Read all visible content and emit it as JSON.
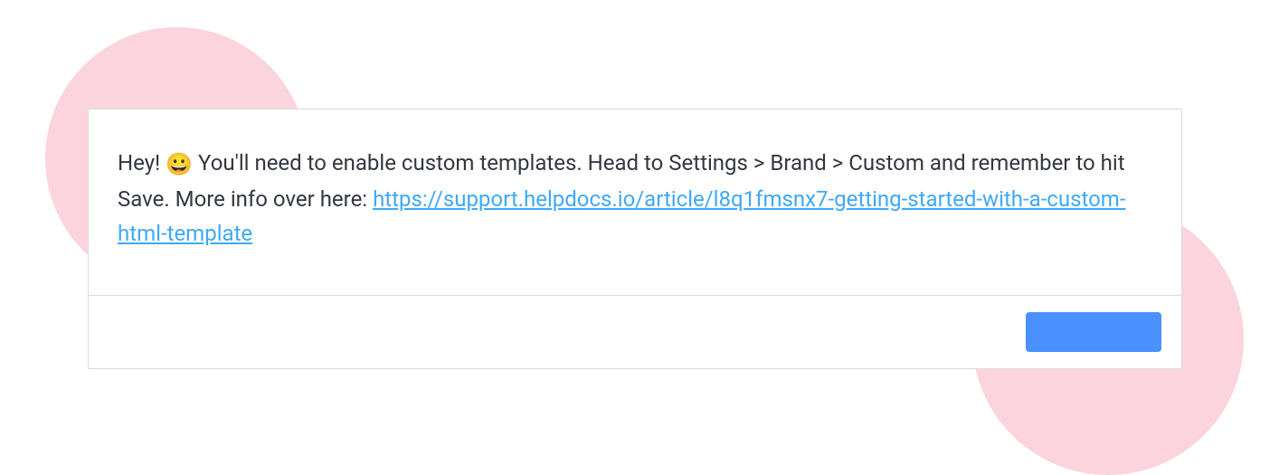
{
  "message": {
    "prefix": "Hey! ",
    "emoji": "😀",
    "text_after_emoji": " You'll need to enable custom templates. Head to Settings > Brand > Custom and remember to hit Save. More info over here: ",
    "link_text": "https://support.helpdocs.io/article/l8q1fmsnx7-getting-started-with-a-custom-html-template",
    "link_href": "https://support.helpdocs.io/article/l8q1fmsnx7-getting-started-with-a-custom-html-template"
  },
  "footer": {
    "button_label": ""
  }
}
